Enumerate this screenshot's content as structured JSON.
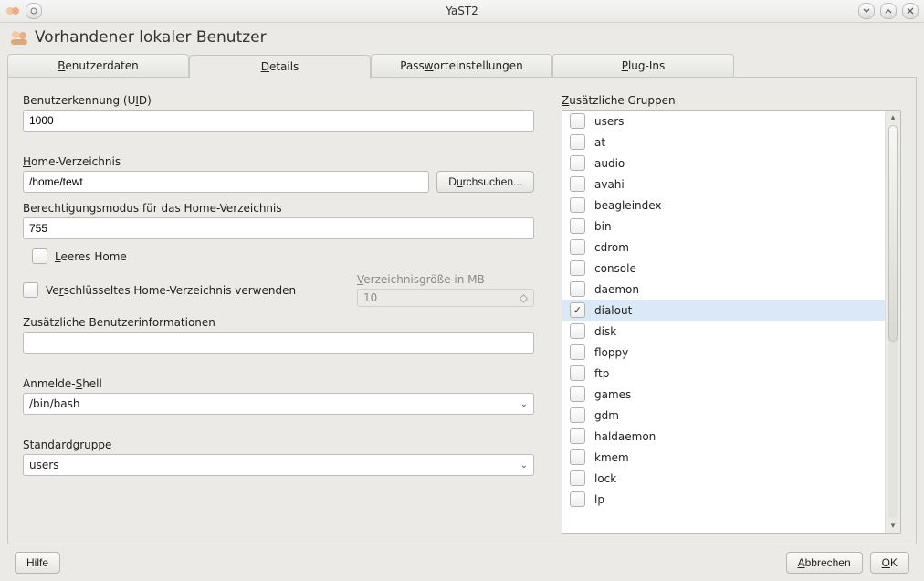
{
  "window": {
    "title": "YaST2"
  },
  "page": {
    "title": "Vorhandener lokaler Benutzer"
  },
  "tabs": [
    {
      "label": "Benutzerdaten",
      "accel_prefix": "B",
      "rest": "enutzerdaten"
    },
    {
      "label": "Details",
      "accel_prefix": "D",
      "rest": "etails",
      "active": true
    },
    {
      "label": "Passworteinstellungen",
      "prefix": "Pass",
      "accel": "w",
      "rest": "orteinstellungen"
    },
    {
      "label": "Plug-Ins",
      "accel_prefix": "P",
      "rest": "lug-Ins"
    }
  ],
  "fields": {
    "uid": {
      "label_pre": "Benutzerkennung (U",
      "label_u": "I",
      "label_post": "D)",
      "value": "1000"
    },
    "home": {
      "label_u": "H",
      "label_rest": "ome-Verzeichnis",
      "value": "/home/tewt"
    },
    "browse": {
      "pre": "D",
      "u": "u",
      "rest": "rchsuchen..."
    },
    "perm": {
      "label": "Berechtigungsmodus für das Home-Verzeichnis",
      "value": "755"
    },
    "empty_home": {
      "u": "L",
      "rest": "eeres Home"
    },
    "dirsize": {
      "label_pre": "",
      "u": "V",
      "rest": "erzeichnisgröße in MB",
      "value": "10"
    },
    "enc_home": {
      "pre": "Ve",
      "u": "r",
      "rest": "schlüsseltes Home-Verzeichnis verwenden"
    },
    "addinfo": {
      "label": "Zusätzliche Benutzerinformationen",
      "value": ""
    },
    "shell": {
      "pre": "Anmelde-",
      "u": "S",
      "rest": "hell",
      "value": "/bin/bash"
    },
    "defgroup": {
      "label": "Standardgruppe",
      "value": "users"
    },
    "addgroups": {
      "u": "Z",
      "rest": "usätzliche Gruppen"
    }
  },
  "groups": [
    {
      "name": "users",
      "checked": false
    },
    {
      "name": "at",
      "checked": false
    },
    {
      "name": "audio",
      "checked": false
    },
    {
      "name": "avahi",
      "checked": false
    },
    {
      "name": "beagleindex",
      "checked": false
    },
    {
      "name": "bin",
      "checked": false
    },
    {
      "name": "cdrom",
      "checked": false
    },
    {
      "name": "console",
      "checked": false
    },
    {
      "name": "daemon",
      "checked": false
    },
    {
      "name": "dialout",
      "checked": true,
      "selected": true
    },
    {
      "name": "disk",
      "checked": false
    },
    {
      "name": "floppy",
      "checked": false
    },
    {
      "name": "ftp",
      "checked": false
    },
    {
      "name": "games",
      "checked": false
    },
    {
      "name": "gdm",
      "checked": false
    },
    {
      "name": "haldaemon",
      "checked": false
    },
    {
      "name": "kmem",
      "checked": false
    },
    {
      "name": "lock",
      "checked": false
    },
    {
      "name": "lp",
      "checked": false
    }
  ],
  "footer": {
    "help": {
      "label": "Hilfe"
    },
    "cancel": {
      "pre": "",
      "u": "A",
      "rest": "bbrechen"
    },
    "ok": {
      "u": "O",
      "rest": "K"
    }
  }
}
